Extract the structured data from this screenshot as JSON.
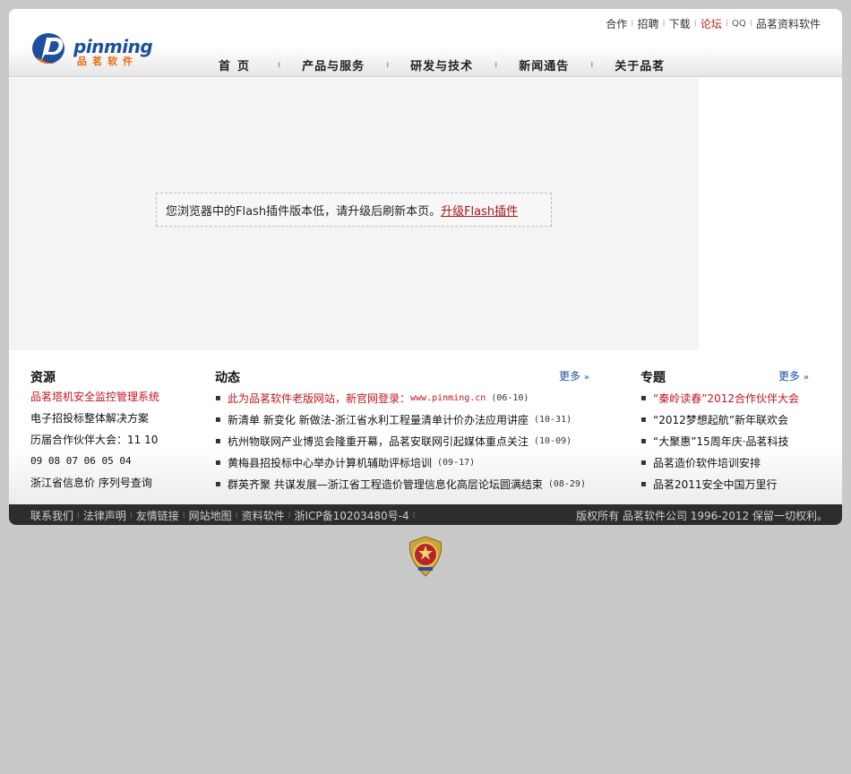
{
  "header": {
    "logo_text": "pinming",
    "logo_sub": "品茗软件",
    "top_links": [
      {
        "label": "合作",
        "style": "normal"
      },
      {
        "label": "招聘",
        "style": "normal"
      },
      {
        "label": "下载",
        "style": "normal"
      },
      {
        "label": "论坛",
        "style": "hot"
      },
      {
        "label": "QQ",
        "style": "qq"
      },
      {
        "label": "品茗资料软件",
        "style": "normal"
      }
    ],
    "nav": [
      {
        "label": "首页"
      },
      {
        "label": "产品与服务"
      },
      {
        "label": "研发与技术"
      },
      {
        "label": "新闻通告"
      },
      {
        "label": "关于品茗"
      }
    ]
  },
  "banner": {
    "flash_text": "您浏览器中的Flash插件版本低，请升级后刷新本页。",
    "flash_link": "升级Flash插件"
  },
  "resources": {
    "title": "资源",
    "items": [
      {
        "label": "品茗塔机安全监控管理系统",
        "hot": true
      },
      {
        "label": "电子招投标整体解决方案",
        "hot": false
      },
      {
        "label": "历届合作伙伴大会：11 10",
        "hot": false
      },
      {
        "label": "09 08 07 06 05 04",
        "hot": false,
        "mono": true
      },
      {
        "label": "浙江省信息价 序列号查询",
        "hot": false
      }
    ]
  },
  "news": {
    "title": "动态",
    "more": "更多",
    "items": [
      {
        "text": "此为品茗软件老版网站，新官网登录：",
        "url": "www.pinming.cn",
        "date": "(06-10)",
        "hot": true
      },
      {
        "text": "新清单 新变化 新做法-浙江省水利工程量清单计价办法应用讲座",
        "date": "(10-31)",
        "hot": false
      },
      {
        "text": "杭州物联网产业博览会隆重开幕，品茗安联网引起媒体重点关注",
        "date": "(10-09)",
        "hot": false
      },
      {
        "text": "黄梅县招投标中心举办计算机辅助评标培训",
        "date": "(09-17)",
        "hot": false
      },
      {
        "text": "群英齐聚 共谋发展—浙江省工程造价管理信息化高层论坛圆满结束",
        "date": "(08-29)",
        "hot": false
      }
    ]
  },
  "topics": {
    "title": "专题",
    "more": "更多",
    "items": [
      {
        "label": "“秦岭读春”2012合作伙伴大会",
        "hot": true
      },
      {
        "label": "“2012梦想起航”新年联欢会",
        "hot": false
      },
      {
        "label": "“大聚惠”15周年庆·品茗科技",
        "hot": false
      },
      {
        "label": "品茗造价软件培训安排",
        "hot": false
      },
      {
        "label": "品茗2011安全中国万里行",
        "hot": false
      }
    ]
  },
  "footer": {
    "links": [
      "联系我们",
      "法律声明",
      "友情链接",
      "网站地图",
      "资料软件",
      "浙ICP备10203480号-4"
    ],
    "copyright": "版权所有 品茗软件公司 1996-2012 保留一切权利。"
  },
  "emblem": {
    "icon": "police-emblem-icon"
  },
  "colors": {
    "accent_red": "#c4161c",
    "brand_blue": "#1d4f9c",
    "brand_orange": "#e86d10"
  }
}
